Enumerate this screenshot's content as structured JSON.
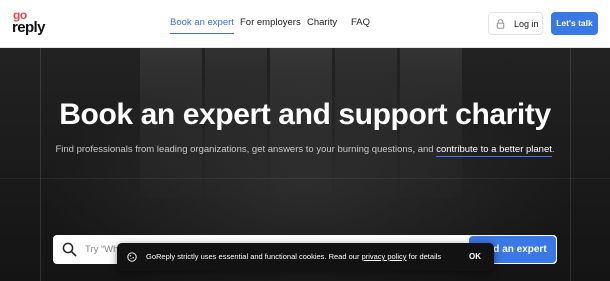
{
  "brand": {
    "logo_top": "go",
    "logo_bottom": "reply",
    "accent_color": "#3a78e6",
    "logo_color": "#e24848"
  },
  "nav": {
    "items": [
      {
        "label": "Book an expert",
        "active": true
      },
      {
        "label": "For employers",
        "active": false
      },
      {
        "label": "Charity",
        "active": false
      },
      {
        "label": "FAQ",
        "active": false
      }
    ],
    "login_label": "Log in",
    "login_icon": "lock-icon",
    "cta_label": "Let's talk"
  },
  "hero": {
    "title": "Book an expert and support charity",
    "subtitle_before": "Find professionals from leading organizations, get answers to your burning questions, and ",
    "subtitle_highlight": "contribute to a better planet",
    "subtitle_after": "."
  },
  "search": {
    "placeholder": "Try “Wh",
    "icon": "search-icon",
    "button_label": "Find an expert"
  },
  "cookie_banner": {
    "icon": "cookie-icon",
    "text_before": "GoReply strictly uses essential and functional cookies. Read our ",
    "link_label": "privacy policy",
    "text_after": " for details",
    "ok_label": "OK"
  }
}
